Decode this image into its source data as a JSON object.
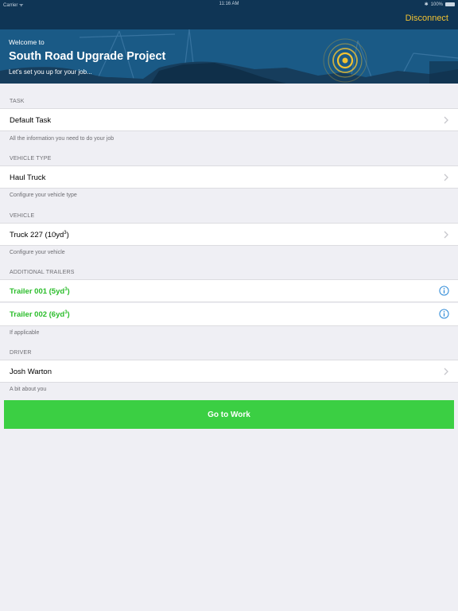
{
  "status_bar": {
    "carrier": "Carrier ᯤ",
    "time": "11:16 AM",
    "battery": "100%"
  },
  "nav": {
    "disconnect_label": "Disconnect"
  },
  "hero": {
    "welcome": "Welcome to",
    "project": "South Road Upgrade Project",
    "subtitle": "Let's set you up for your job..."
  },
  "sections": {
    "task": {
      "header": "TASK",
      "value": "Default Task",
      "footer": "All the information you need to do your job"
    },
    "vehicle_type": {
      "header": "VEHICLE TYPE",
      "value": "Haul Truck",
      "footer": "Configure your vehicle type"
    },
    "vehicle": {
      "header": "VEHICLE",
      "value": "Truck 227 (10yd",
      "value_sup": "3",
      "value_end": ")",
      "footer": "Configure your vehicle"
    },
    "trailers": {
      "header": "ADDITIONAL TRAILERS",
      "items": [
        {
          "label": "Trailer 001 (5yd",
          "sup": "3",
          "end": ")"
        },
        {
          "label": "Trailer 002 (6yd",
          "sup": "3",
          "end": ")"
        }
      ],
      "footer": "If applicable"
    },
    "driver": {
      "header": "DRIVER",
      "value": "Josh Warton",
      "footer": "A bit about you"
    }
  },
  "go_button_label": "Go to Work",
  "colors": {
    "nav_bg": "#0f3555",
    "hero_bg": "#1a5a86",
    "accent_yellow": "#f1c232",
    "green_text": "#2bbd2b",
    "go_button": "#3bcf43",
    "info_blue": "#1a7fd4"
  }
}
